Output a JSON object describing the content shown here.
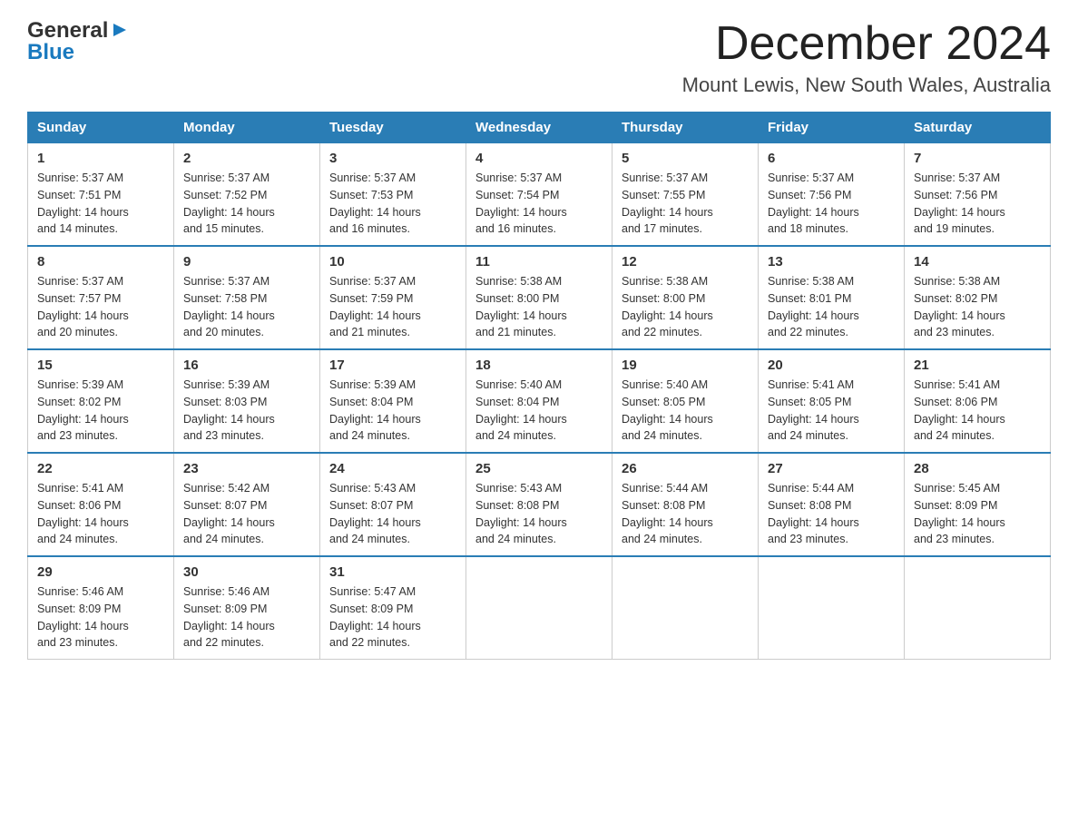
{
  "header": {
    "logo_general": "General",
    "logo_blue": "Blue",
    "month_title": "December 2024",
    "location": "Mount Lewis, New South Wales, Australia"
  },
  "weekdays": [
    "Sunday",
    "Monday",
    "Tuesday",
    "Wednesday",
    "Thursday",
    "Friday",
    "Saturday"
  ],
  "weeks": [
    [
      {
        "day": "1",
        "sunrise": "5:37 AM",
        "sunset": "7:51 PM",
        "daylight": "14 hours and 14 minutes."
      },
      {
        "day": "2",
        "sunrise": "5:37 AM",
        "sunset": "7:52 PM",
        "daylight": "14 hours and 15 minutes."
      },
      {
        "day": "3",
        "sunrise": "5:37 AM",
        "sunset": "7:53 PM",
        "daylight": "14 hours and 16 minutes."
      },
      {
        "day": "4",
        "sunrise": "5:37 AM",
        "sunset": "7:54 PM",
        "daylight": "14 hours and 16 minutes."
      },
      {
        "day": "5",
        "sunrise": "5:37 AM",
        "sunset": "7:55 PM",
        "daylight": "14 hours and 17 minutes."
      },
      {
        "day": "6",
        "sunrise": "5:37 AM",
        "sunset": "7:56 PM",
        "daylight": "14 hours and 18 minutes."
      },
      {
        "day": "7",
        "sunrise": "5:37 AM",
        "sunset": "7:56 PM",
        "daylight": "14 hours and 19 minutes."
      }
    ],
    [
      {
        "day": "8",
        "sunrise": "5:37 AM",
        "sunset": "7:57 PM",
        "daylight": "14 hours and 20 minutes."
      },
      {
        "day": "9",
        "sunrise": "5:37 AM",
        "sunset": "7:58 PM",
        "daylight": "14 hours and 20 minutes."
      },
      {
        "day": "10",
        "sunrise": "5:37 AM",
        "sunset": "7:59 PM",
        "daylight": "14 hours and 21 minutes."
      },
      {
        "day": "11",
        "sunrise": "5:38 AM",
        "sunset": "8:00 PM",
        "daylight": "14 hours and 21 minutes."
      },
      {
        "day": "12",
        "sunrise": "5:38 AM",
        "sunset": "8:00 PM",
        "daylight": "14 hours and 22 minutes."
      },
      {
        "day": "13",
        "sunrise": "5:38 AM",
        "sunset": "8:01 PM",
        "daylight": "14 hours and 22 minutes."
      },
      {
        "day": "14",
        "sunrise": "5:38 AM",
        "sunset": "8:02 PM",
        "daylight": "14 hours and 23 minutes."
      }
    ],
    [
      {
        "day": "15",
        "sunrise": "5:39 AM",
        "sunset": "8:02 PM",
        "daylight": "14 hours and 23 minutes."
      },
      {
        "day": "16",
        "sunrise": "5:39 AM",
        "sunset": "8:03 PM",
        "daylight": "14 hours and 23 minutes."
      },
      {
        "day": "17",
        "sunrise": "5:39 AM",
        "sunset": "8:04 PM",
        "daylight": "14 hours and 24 minutes."
      },
      {
        "day": "18",
        "sunrise": "5:40 AM",
        "sunset": "8:04 PM",
        "daylight": "14 hours and 24 minutes."
      },
      {
        "day": "19",
        "sunrise": "5:40 AM",
        "sunset": "8:05 PM",
        "daylight": "14 hours and 24 minutes."
      },
      {
        "day": "20",
        "sunrise": "5:41 AM",
        "sunset": "8:05 PM",
        "daylight": "14 hours and 24 minutes."
      },
      {
        "day": "21",
        "sunrise": "5:41 AM",
        "sunset": "8:06 PM",
        "daylight": "14 hours and 24 minutes."
      }
    ],
    [
      {
        "day": "22",
        "sunrise": "5:41 AM",
        "sunset": "8:06 PM",
        "daylight": "14 hours and 24 minutes."
      },
      {
        "day": "23",
        "sunrise": "5:42 AM",
        "sunset": "8:07 PM",
        "daylight": "14 hours and 24 minutes."
      },
      {
        "day": "24",
        "sunrise": "5:43 AM",
        "sunset": "8:07 PM",
        "daylight": "14 hours and 24 minutes."
      },
      {
        "day": "25",
        "sunrise": "5:43 AM",
        "sunset": "8:08 PM",
        "daylight": "14 hours and 24 minutes."
      },
      {
        "day": "26",
        "sunrise": "5:44 AM",
        "sunset": "8:08 PM",
        "daylight": "14 hours and 24 minutes."
      },
      {
        "day": "27",
        "sunrise": "5:44 AM",
        "sunset": "8:08 PM",
        "daylight": "14 hours and 23 minutes."
      },
      {
        "day": "28",
        "sunrise": "5:45 AM",
        "sunset": "8:09 PM",
        "daylight": "14 hours and 23 minutes."
      }
    ],
    [
      {
        "day": "29",
        "sunrise": "5:46 AM",
        "sunset": "8:09 PM",
        "daylight": "14 hours and 23 minutes."
      },
      {
        "day": "30",
        "sunrise": "5:46 AM",
        "sunset": "8:09 PM",
        "daylight": "14 hours and 22 minutes."
      },
      {
        "day": "31",
        "sunrise": "5:47 AM",
        "sunset": "8:09 PM",
        "daylight": "14 hours and 22 minutes."
      },
      null,
      null,
      null,
      null
    ]
  ],
  "labels": {
    "sunrise": "Sunrise:",
    "sunset": "Sunset:",
    "daylight": "Daylight:"
  }
}
